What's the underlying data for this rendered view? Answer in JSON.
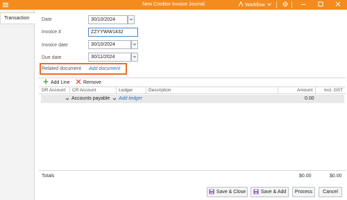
{
  "window": {
    "title": "New Creditor Invoice Journal",
    "workflow_label": "Workflow"
  },
  "tabs": [
    {
      "label": "Transaction"
    }
  ],
  "form": {
    "date": {
      "label": "Date",
      "value": "30/10/2024"
    },
    "invoice_number": {
      "label": "Invoice #",
      "value": "ZZYYWW1432"
    },
    "invoice_date": {
      "label": "Invoice date",
      "value": "30/10/2024"
    },
    "due_date": {
      "label": "Due date",
      "value": "30/11/2024"
    },
    "related_document": {
      "label": "Related document",
      "link": "Add document"
    }
  },
  "line_toolbar": {
    "add_line": "Add Line",
    "remove": "Remove"
  },
  "table": {
    "columns": [
      "DR Account",
      "CR Account",
      "Ledger",
      "Description",
      "Amount",
      "Incl. GST"
    ],
    "group_row": {
      "account": "Accounts payable",
      "ledger_link": "Add ledger",
      "amount": "0.00"
    }
  },
  "totals": {
    "label": "Totals",
    "amount": "$0.00",
    "incl_gst": "$0.00"
  },
  "buttons": {
    "save_close": "Save & Close",
    "save_add": "Save & Add",
    "process": "Process",
    "cancel": "Cancel"
  },
  "colors": {
    "titlebar": "#f38b1e",
    "highlight": "#f06b22",
    "link": "#1f6fbf",
    "add_icon": "#2e9b3a",
    "remove_icon": "#d8372b"
  }
}
